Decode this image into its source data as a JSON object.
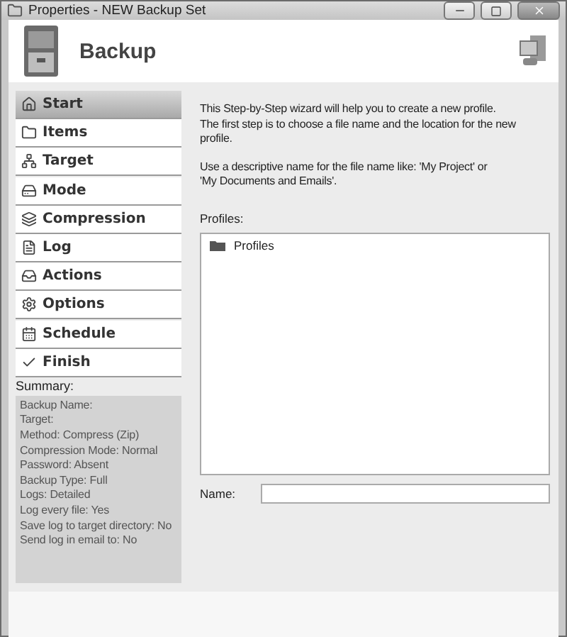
{
  "window": {
    "title": "Properties - NEW Backup Set"
  },
  "header": {
    "title": "Backup"
  },
  "steps": [
    {
      "label": "Start",
      "selected": true
    },
    {
      "label": "Items",
      "selected": false
    },
    {
      "label": "Target",
      "selected": false
    },
    {
      "label": "Mode",
      "selected": false
    },
    {
      "label": "Compression",
      "selected": false
    },
    {
      "label": "Log",
      "selected": false
    },
    {
      "label": "Actions",
      "selected": false
    },
    {
      "label": "Options",
      "selected": false
    },
    {
      "label": "Schedule",
      "selected": false
    },
    {
      "label": "Finish",
      "selected": false
    }
  ],
  "summary": {
    "label": "Summary:",
    "lines": [
      "Backup Name:",
      "Target:",
      "Method: Compress (Zip)",
      "Compression Mode: Normal",
      "Password: Absent",
      "Backup Type: Full",
      "Logs: Detailed",
      "Log every file: Yes",
      "Save log to target directory: No",
      "Send log in email to: No"
    ]
  },
  "intro": [
    "This Step-by-Step wizard will help you to create a new profile.\nThe first step is to choose a file name and the location for the new profile.",
    "Use a descriptive name for the file name like: 'My Project' or\n'My Documents and Emails'."
  ],
  "profiles": {
    "label": "Profiles:",
    "items": [
      "Profiles"
    ]
  },
  "name_field": {
    "label": "Name:"
  }
}
